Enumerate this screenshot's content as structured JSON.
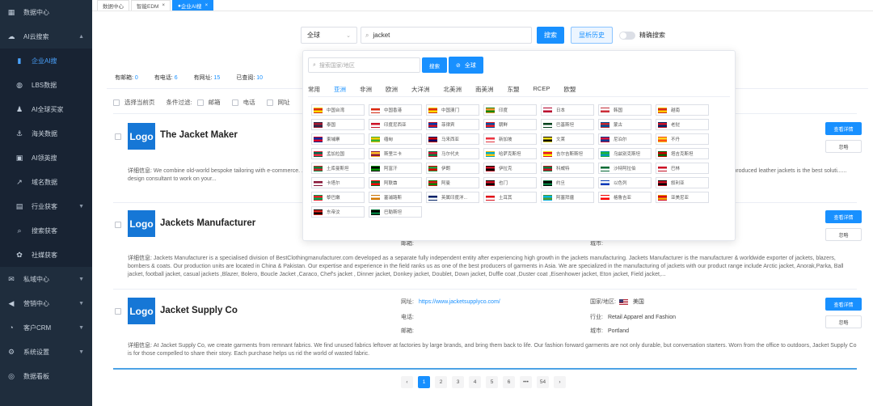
{
  "sidebar": {
    "items": [
      {
        "label": "数据中心",
        "icon": "dashboard-icon",
        "arrow": ""
      },
      {
        "label": "AI云搜索",
        "icon": "search-cloud-icon",
        "arrow": "▲"
      }
    ],
    "subitems": [
      {
        "label": "企业AI搜",
        "icon": "chart-icon",
        "active": true
      },
      {
        "label": "LBS数据",
        "icon": "globe-icon"
      },
      {
        "label": "AI全球买家",
        "icon": "user-icon"
      },
      {
        "label": "海关数据",
        "icon": "ship-icon"
      },
      {
        "label": "AI领英搜",
        "icon": "linkedin-icon"
      },
      {
        "label": "域名数据",
        "icon": "external-link-icon"
      },
      {
        "label": "行业获客",
        "icon": "briefcase-icon",
        "arrow": "▼"
      },
      {
        "label": "搜索获客",
        "icon": "search-icon"
      },
      {
        "label": "社媒获客",
        "icon": "social-icon"
      }
    ],
    "items2": [
      {
        "label": "私域中心",
        "icon": "message-icon",
        "arrow": "▼"
      },
      {
        "label": "营销中心",
        "icon": "megaphone-icon",
        "arrow": "▼"
      },
      {
        "label": "客户CRM",
        "icon": "crm-icon",
        "arrow": "▼"
      },
      {
        "label": "系统设置",
        "icon": "settings-icon",
        "arrow": "▼"
      },
      {
        "label": "数据看板",
        "icon": "board-icon",
        "arrow": ""
      }
    ]
  },
  "tabs": [
    {
      "label": "数据中心",
      "closable": false,
      "active": false
    },
    {
      "label": "智能EDM",
      "closable": true,
      "active": false
    },
    {
      "label": "企业AI搜",
      "closable": true,
      "active": true
    }
  ],
  "search": {
    "scope": "全球",
    "query": "jacket",
    "search_btn": "搜索",
    "history_btn": "显析历史",
    "exact_label": "精确搜索"
  },
  "stats": [
    {
      "label": "有邮箱:",
      "value": "0"
    },
    {
      "label": "有电话:",
      "value": "6"
    },
    {
      "label": "有网址:",
      "value": "15"
    },
    {
      "label": "已查阅:",
      "value": "10"
    }
  ],
  "filters": {
    "select_page": "选择当前页",
    "condition": "条件过滤:",
    "email": "邮箱",
    "phone": "电话",
    "web": "网址"
  },
  "popup": {
    "placeholder": "搜索国家/地区",
    "search_btn": "搜索",
    "global_btn": "全球",
    "tabs": [
      "常用",
      "亚洲",
      "非洲",
      "欧洲",
      "大洋洲",
      "北美洲",
      "南美洲",
      "东盟",
      "RCEP",
      "欧盟"
    ],
    "active_tab": 1,
    "countries": [
      {
        "name": "中国台湾",
        "c1": "#de2910",
        "c2": "#ffde00"
      },
      {
        "name": "中国香港",
        "c1": "#de2910",
        "c2": "#ffffff"
      },
      {
        "name": "中国澳门",
        "c1": "#de2910",
        "c2": "#ffde00"
      },
      {
        "name": "印度",
        "c1": "#ff9933",
        "c2": "#138808"
      },
      {
        "name": "日本",
        "c1": "#ffffff",
        "c2": "#bc002d"
      },
      {
        "name": "韩国",
        "c1": "#ffffff",
        "c2": "#cd2e3a"
      },
      {
        "name": "越南",
        "c1": "#da251d",
        "c2": "#ffcd00"
      },
      {
        "name": "泰国",
        "c1": "#a51931",
        "c2": "#2d2a4a"
      },
      {
        "name": "印度尼西亚",
        "c1": "#ce1126",
        "c2": "#ffffff"
      },
      {
        "name": "菲律宾",
        "c1": "#0038a8",
        "c2": "#ce1126"
      },
      {
        "name": "朝鲜",
        "c1": "#024fa2",
        "c2": "#ed1c27"
      },
      {
        "name": "巴基斯坦",
        "c1": "#01411c",
        "c2": "#ffffff"
      },
      {
        "name": "蒙古",
        "c1": "#c4272f",
        "c2": "#015197"
      },
      {
        "name": "老挝",
        "c1": "#ce1126",
        "c2": "#002868"
      },
      {
        "name": "柬埔寨",
        "c1": "#032ea1",
        "c2": "#e00025"
      },
      {
        "name": "缅甸",
        "c1": "#fecb00",
        "c2": "#34b233"
      },
      {
        "name": "马来西亚",
        "c1": "#cc0001",
        "c2": "#010066"
      },
      {
        "name": "新加坡",
        "c1": "#ef3340",
        "c2": "#ffffff"
      },
      {
        "name": "文莱",
        "c1": "#f7e017",
        "c2": "#000000"
      },
      {
        "name": "尼泊尔",
        "c1": "#dc143c",
        "c2": "#003893"
      },
      {
        "name": "不丹",
        "c1": "#ffd520",
        "c2": "#ff4e12"
      },
      {
        "name": "孟加拉国",
        "c1": "#006a4e",
        "c2": "#f42a41"
      },
      {
        "name": "斯里兰卡",
        "c1": "#ffbe29",
        "c2": "#8d153a"
      },
      {
        "name": "马尔代夫",
        "c1": "#d21034",
        "c2": "#007e3a"
      },
      {
        "name": "哈萨克斯坦",
        "c1": "#00afca",
        "c2": "#fec50c"
      },
      {
        "name": "吉尔吉斯斯坦",
        "c1": "#e8112d",
        "c2": "#ffef00"
      },
      {
        "name": "乌兹别克斯坦",
        "c1": "#1eb53a",
        "c2": "#0099b5"
      },
      {
        "name": "塔吉克斯坦",
        "c1": "#cc0000",
        "c2": "#006600"
      },
      {
        "name": "土库曼斯坦",
        "c1": "#00843d",
        "c2": "#d22630"
      },
      {
        "name": "阿富汗",
        "c1": "#000000",
        "c2": "#009900"
      },
      {
        "name": "伊朗",
        "c1": "#239f40",
        "c2": "#da0000"
      },
      {
        "name": "伊拉克",
        "c1": "#ce1126",
        "c2": "#000000"
      },
      {
        "name": "科威特",
        "c1": "#007a3d",
        "c2": "#ce1126"
      },
      {
        "name": "沙特阿拉伯",
        "c1": "#006c35",
        "c2": "#ffffff"
      },
      {
        "name": "巴林",
        "c1": "#ce1126",
        "c2": "#ffffff"
      },
      {
        "name": "卡塔尔",
        "c1": "#8a1538",
        "c2": "#ffffff"
      },
      {
        "name": "阿联酋",
        "c1": "#00732f",
        "c2": "#ff0000"
      },
      {
        "name": "阿曼",
        "c1": "#db161b",
        "c2": "#008000"
      },
      {
        "name": "也门",
        "c1": "#ce1126",
        "c2": "#000000"
      },
      {
        "name": "约旦",
        "c1": "#000000",
        "c2": "#007a3d"
      },
      {
        "name": "以色列",
        "c1": "#ffffff",
        "c2": "#0038b8"
      },
      {
        "name": "叙利亚",
        "c1": "#ce1126",
        "c2": "#000000"
      },
      {
        "name": "黎巴嫩",
        "c1": "#ed1c24",
        "c2": "#00a651"
      },
      {
        "name": "塞浦路斯",
        "c1": "#ffffff",
        "c2": "#d57800"
      },
      {
        "name": "英属印度洋...",
        "c1": "#012169",
        "c2": "#ffffff"
      },
      {
        "name": "土耳其",
        "c1": "#e30a17",
        "c2": "#ffffff"
      },
      {
        "name": "阿塞拜疆",
        "c1": "#00b5e2",
        "c2": "#509e2f"
      },
      {
        "name": "格鲁吉亚",
        "c1": "#ffffff",
        "c2": "#ff0000"
      },
      {
        "name": "亚美尼亚",
        "c1": "#d90012",
        "c2": "#f2a800"
      },
      {
        "name": "东帝汶",
        "c1": "#dc241f",
        "c2": "#000000"
      },
      {
        "name": "巴勒斯坦",
        "c1": "#000000",
        "c2": "#007a3d"
      }
    ]
  },
  "companies": [
    {
      "name": "The Jacket Maker",
      "logo": "Logo",
      "detail_label": "详细信息:",
      "detail": "We combine old-world bespoke tailoring with e-commerce. ...... the design they want, color they prefer, and details they love. We are simplifying personalization in fashi...... leather jackets starting at $350 being as affordable as mass-produced leather jackets is the best soluti...... design consultant to work on your...",
      "view_btn": "查看详情",
      "ignore_btn": "忽略"
    },
    {
      "name": "Jackets Manufacturer",
      "logo": "Logo",
      "email_label": "邮箱:",
      "city_label": "城市:",
      "detail_label": "详细信息:",
      "detail": "Jackets Manufacturer is a specialised division of BestClothingmanufacturer.com developed as a separate fully independent entity after experiencing high growth in the jackets manufacturing. Jackets Manufacturer is the manufacturer & worldwide exporter of jackets, blazers, bombers & coats. Our production units are located in China & Pakistan. Our expertise and experience in the field ranks us as one of the best producers of garments in Asia. We are specialized in the manufacturing of jackets with our product range include Arctic jacket, Anorak,Parka, Ball jacket, football jacket, casual jackets ,Blazer, Bolero, Boucle Jacket ,Caraco, Chef's jacket , Dinner jacket, Donkey jacket, Doublet, Down jacket, Duffle coat ,Duster coat ,Eisenhower jacket, Eton jacket, Field jacket,...",
      "view_btn": "查看详情",
      "ignore_btn": "忽略"
    },
    {
      "name": "Jacket Supply Co",
      "logo": "Logo",
      "web_label": "网址:",
      "web": "https://www.jacketsupplyco.com/",
      "phone_label": "电话:",
      "email_label": "邮箱:",
      "country_label": "国家/地区:",
      "country": "美国",
      "industry_label": "行业:",
      "industry": "Retail Apparel and Fashion",
      "city_label": "城市:",
      "city": "Portland",
      "detail_label": "详细信息:",
      "detail": "At Jacket Supply Co, we create garments from remnant fabrics. We find unused fabrics leftover at factories by large brands, and bring them back to life. Our fashion forward garments are not only durable, but conversation starters. Worn from the office to outdoors, Jacket Supply Co is for those compelled to share their story. Each purchase helps us rid the world of wasted fabric.",
      "view_btn": "查看详情",
      "ignore_btn": "忽略"
    }
  ],
  "pager": {
    "prev": "‹",
    "next": "›",
    "pages": [
      "1",
      "2",
      "3",
      "4",
      "5",
      "6",
      "•••",
      "54"
    ],
    "active": 0
  },
  "colors": {
    "accent": "#1890ff",
    "sidebar_bg": "#1f2d3d"
  }
}
